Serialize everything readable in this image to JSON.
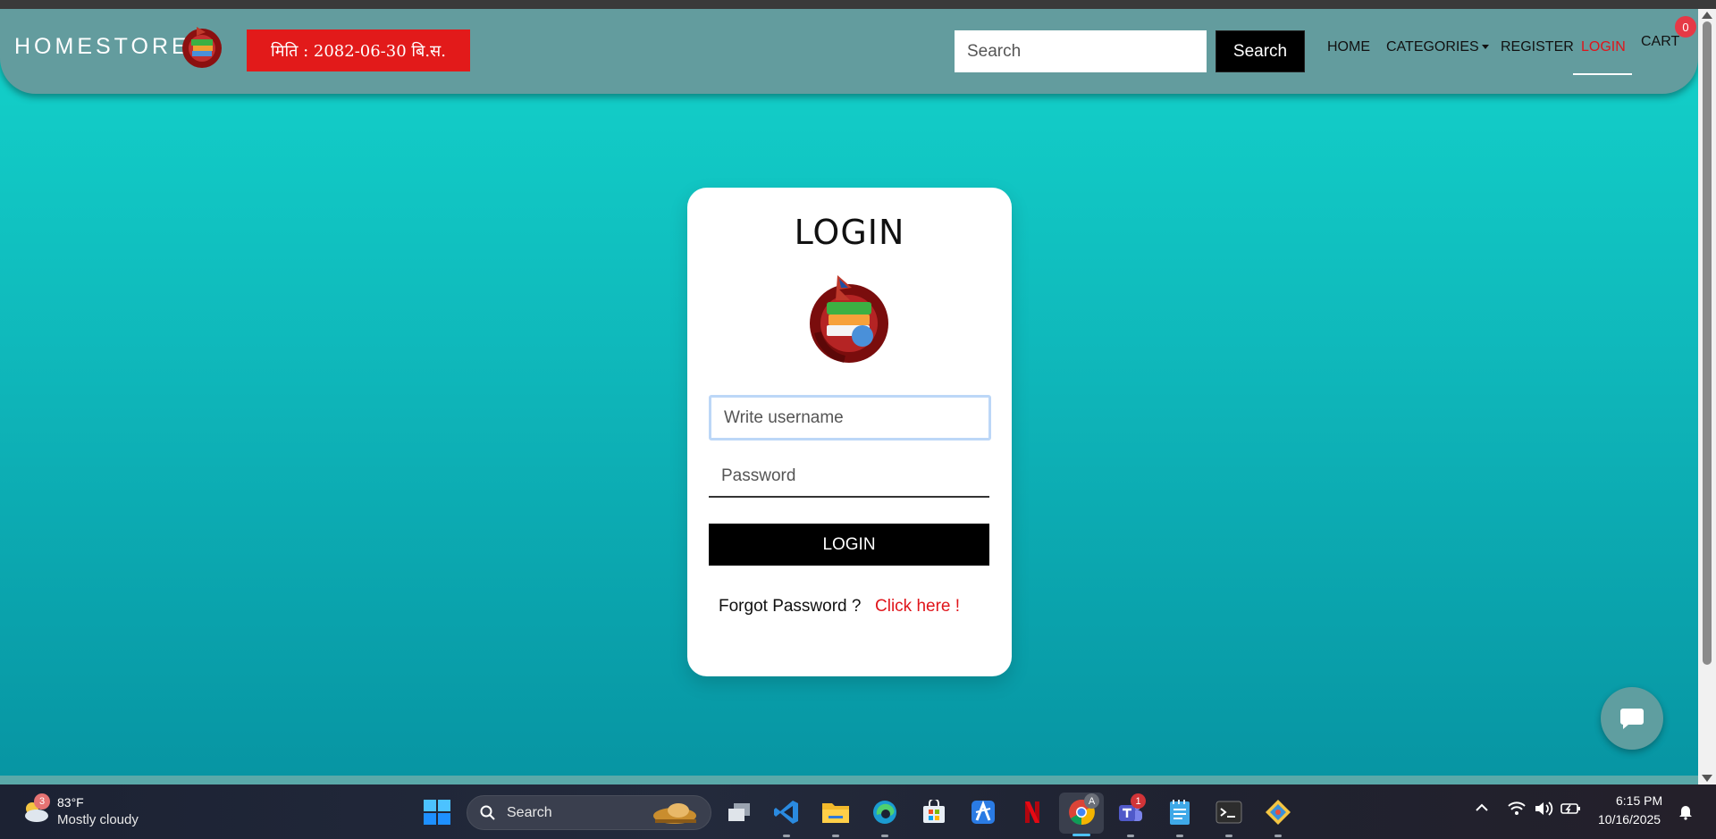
{
  "navbar": {
    "brand": "HOMESTORE",
    "date_badge": "मिति : 2082-06-30 बि.स.",
    "search_placeholder": "Search",
    "search_button": "Search",
    "links": {
      "home": "HOME",
      "categories": "CATEGORIES",
      "register": "REGISTER",
      "login": "LOGIN",
      "cart": "CART"
    },
    "cart_count": "0",
    "active_link_color": "#e0151b"
  },
  "login_card": {
    "title": "LOGIN",
    "username_placeholder": "Write username",
    "password_placeholder": "Password",
    "submit_label": "LOGIN",
    "forgot_text": "Forgot Password ?",
    "forgot_link": "Click here !"
  },
  "taskbar": {
    "weather_temp": "83°F",
    "weather_desc": "Mostly cloudy",
    "weather_badge": "3",
    "search_text": "Search",
    "teams_badge": "1",
    "chrome_badge": "A",
    "time": "6:15 PM",
    "date": "10/16/2025",
    "apps": [
      "task-view",
      "vscode",
      "file-explorer",
      "edge",
      "microsoft-store",
      "app-a",
      "netflix",
      "chrome",
      "teams",
      "notepad",
      "terminal",
      "git-app"
    ]
  },
  "colors": {
    "navbar_bg": "#639c9e",
    "date_badge_bg": "#e21a1a",
    "page_gradient_top": "#13d3cb",
    "page_gradient_bottom": "#0795a3"
  }
}
